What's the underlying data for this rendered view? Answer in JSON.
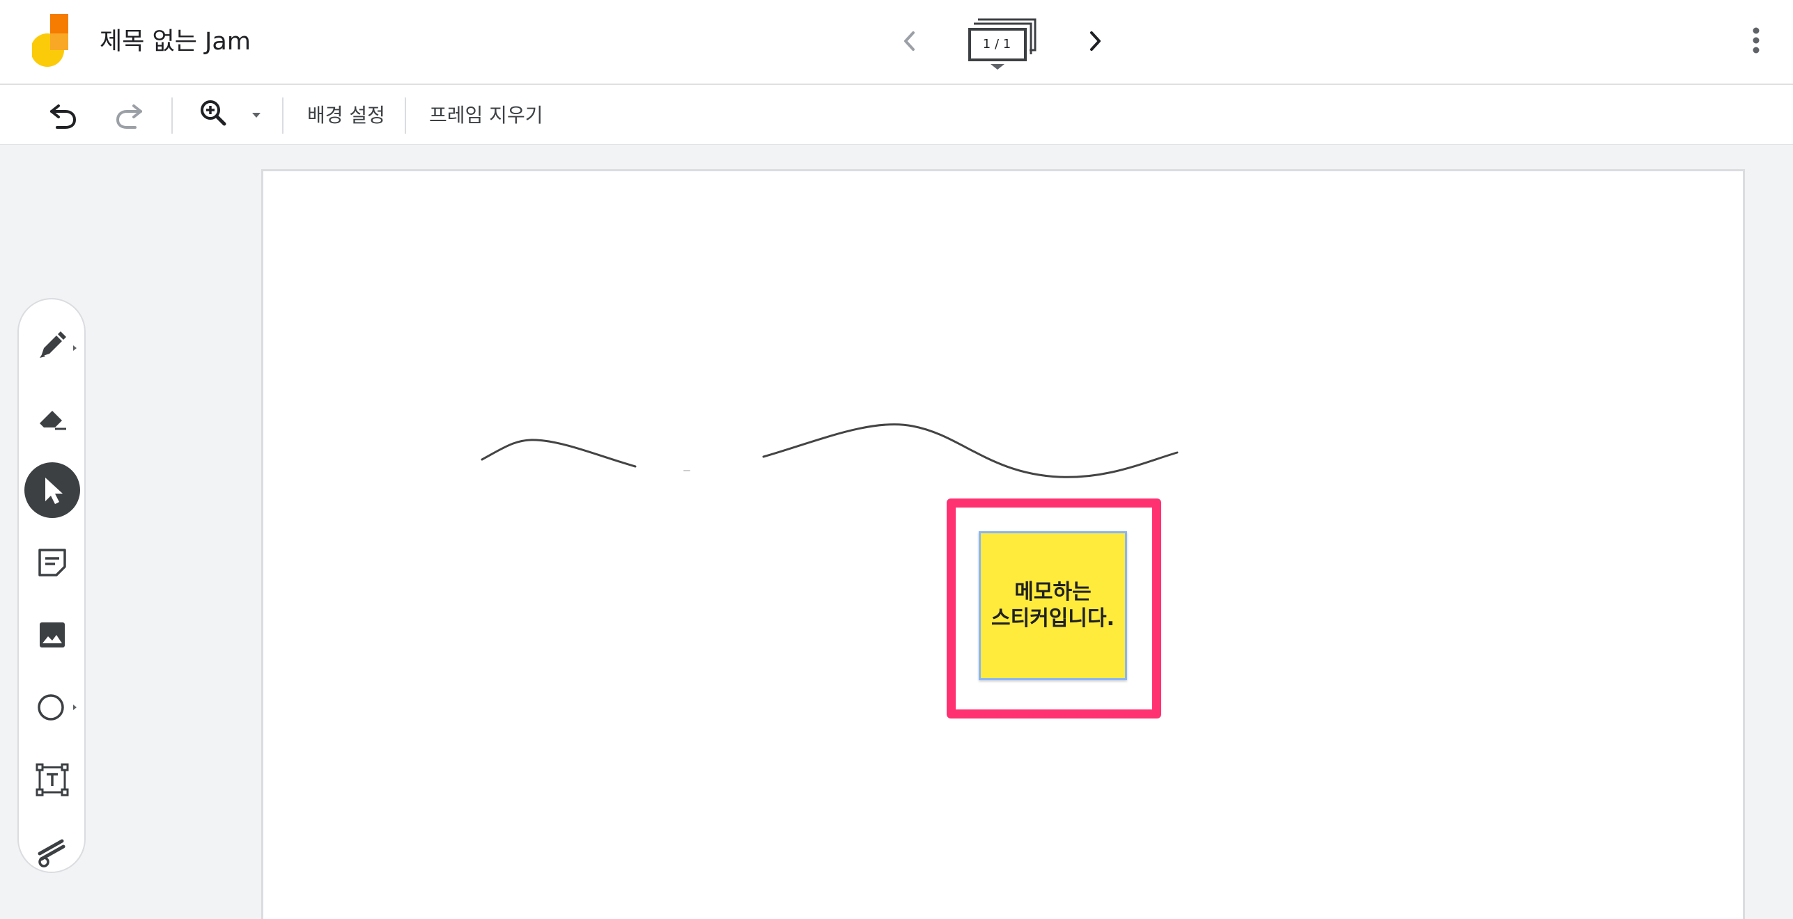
{
  "app": {
    "title": "제목 없는 Jam",
    "logo_icon": "jamboard-logo"
  },
  "header": {
    "frame_indicator": "1 / 1",
    "prev_icon": "chevron-left-icon",
    "next_icon": "chevron-right-icon",
    "more_icon": "more-vert-icon"
  },
  "toolbar": {
    "undo_icon": "undo-icon",
    "redo_icon": "redo-icon",
    "zoom_icon": "zoom-in-icon",
    "set_background_label": "배경 설정",
    "clear_frame_label": "프레임 지우기"
  },
  "tools": [
    {
      "name": "pen",
      "icon": "pen-icon",
      "active": false
    },
    {
      "name": "eraser",
      "icon": "eraser-icon",
      "active": false
    },
    {
      "name": "select",
      "icon": "cursor-icon",
      "active": true
    },
    {
      "name": "sticky-note",
      "icon": "sticky-note-icon",
      "active": false
    },
    {
      "name": "image",
      "icon": "image-icon",
      "active": false
    },
    {
      "name": "shape",
      "icon": "circle-icon",
      "active": false
    },
    {
      "name": "text-box",
      "icon": "text-box-icon",
      "active": false
    },
    {
      "name": "laser",
      "icon": "laser-icon",
      "active": false
    }
  ],
  "canvas": {
    "sticky_note": {
      "text": "메모하는\n스티커입니다.",
      "color": "#ffeb3b",
      "selected_border_color": "#8ab4f8"
    },
    "highlight_color": "#ff3170",
    "stroke_color": "#444444"
  }
}
